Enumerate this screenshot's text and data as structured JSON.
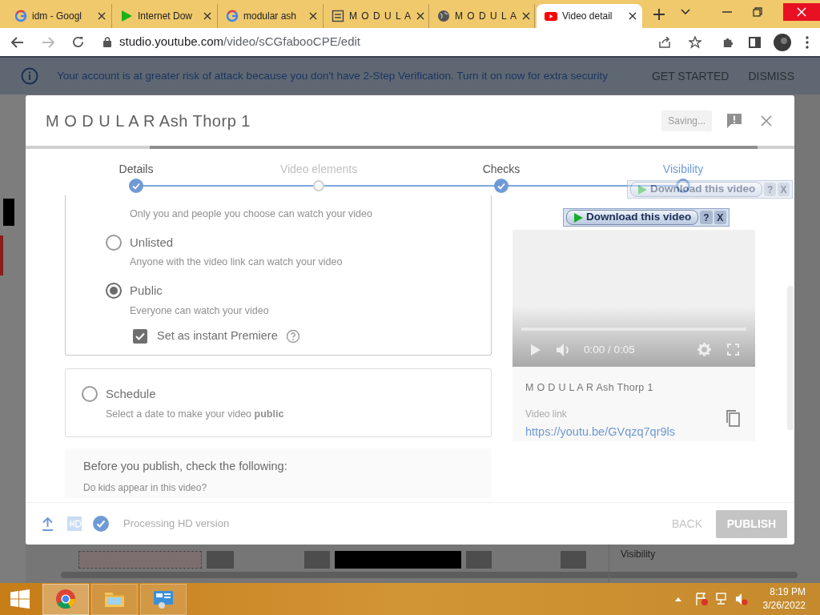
{
  "browser": {
    "tabs": [
      {
        "title": "idm - Googl",
        "kind": "google",
        "selected": false
      },
      {
        "title": "Internet Dow",
        "kind": "play",
        "selected": false
      },
      {
        "title": "modular ash",
        "kind": "google",
        "selected": false
      },
      {
        "title": "M O D U L A",
        "kind": "tile",
        "selected": false
      },
      {
        "title": "M O D U L A",
        "kind": "globe",
        "selected": false
      },
      {
        "title": "Video detail",
        "kind": "video",
        "selected": true
      }
    ],
    "url_host": "studio.youtube.com",
    "url_path": "/video/sCGfabooCPE/edit"
  },
  "banner": {
    "message": "Your account is at greater risk of attack because you don't have 2-Step Verification. Turn it on now for extra security",
    "actions": [
      "GET STARTED",
      "DISMISS"
    ]
  },
  "dialog": {
    "title": "M O D U L A R Ash Thorp 1",
    "status": "Saving...",
    "steps": [
      {
        "label": "Details",
        "kind": "done"
      },
      {
        "label": "Video elements",
        "kind": "todo"
      },
      {
        "label": "Checks",
        "kind": "done"
      },
      {
        "label": "Visibility",
        "kind": "current"
      }
    ],
    "private_description": "Only you and people you choose can watch your video",
    "options": [
      {
        "label": "Unlisted",
        "description": "Anyone with the video link can watch your video",
        "selected": false
      },
      {
        "label": "Public",
        "description": "Everyone can watch your video",
        "selected": true
      }
    ],
    "premiere": {
      "label": "Set as instant Premiere",
      "checked": true
    },
    "schedule": {
      "label": "Schedule",
      "description": "Select a date to make your video **public**",
      "selected": false
    },
    "checklist": {
      "title": "Before you publish, check the following:",
      "question": "Do kids appear in this video?"
    },
    "preview": {
      "time": "0:00 / 0:05",
      "video_title": "M O D U L A R Ash Thorp 1",
      "link_label": "Video link",
      "link": "https://youtu.be/GVqzq7qr9ls"
    },
    "footer": {
      "status": "Processing HD version",
      "back": "BACK",
      "publish": "PUBLISH",
      "publish_disabled": true
    }
  },
  "downloader": [
    {
      "label": "Download this video",
      "help": "?",
      "close": "X",
      "faded": true
    },
    {
      "label": "Download this video",
      "help": "?",
      "close": "X",
      "faded": false
    }
  ],
  "backdrop": {
    "label": "Visibility"
  },
  "taskbar": {
    "apps": [
      {
        "kind": "chrome",
        "active": true
      },
      {
        "kind": "folder",
        "active": false
      },
      {
        "kind": "control-panel",
        "active": false
      }
    ],
    "time": "8:19 PM",
    "date": "3/26/2022"
  }
}
